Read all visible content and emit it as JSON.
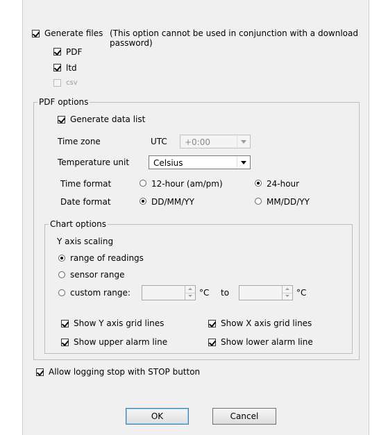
{
  "generate_files": {
    "label": "Generate files",
    "note": "(This option cannot be used in conjunction with a download\npassword)",
    "checked": true,
    "pdf": {
      "label": "PDF",
      "checked": true
    },
    "ltd": {
      "label": "ltd",
      "checked": true
    },
    "csv": {
      "label": "csv",
      "checked": false,
      "disabled": true
    }
  },
  "pdf_options": {
    "legend": "PDF options",
    "generate_data_list": {
      "label": "Generate data list",
      "checked": true
    },
    "time_zone": {
      "label": "Time zone",
      "prefix": "UTC",
      "value": "+0:00"
    },
    "temperature_unit": {
      "label": "Temperature unit",
      "value": "Celsius"
    },
    "time_format": {
      "label": "Time format",
      "option_12": "12-hour (am/pm)",
      "option_24": "24-hour",
      "selected": "24-hour"
    },
    "date_format": {
      "label": "Date format",
      "option_dmy": "DD/MM/YY",
      "option_mdy": "MM/DD/YY",
      "selected": "DD/MM/YY"
    }
  },
  "chart_options": {
    "legend": "Chart options",
    "y_axis_scaling": "Y axis scaling",
    "range_of_readings": "range of readings",
    "sensor_range": "sensor range",
    "custom_range": "custom range:",
    "selected": "range of readings",
    "unit_from": "°C",
    "to": "to",
    "unit_to": "°C",
    "show_y_grid": {
      "label": "Show Y axis grid lines",
      "checked": true
    },
    "show_x_grid": {
      "label": "Show X axis grid lines",
      "checked": true
    },
    "show_upper_alarm": {
      "label": "Show upper alarm line",
      "checked": true
    },
    "show_lower_alarm": {
      "label": "Show lower alarm line",
      "checked": true
    }
  },
  "allow_logging_stop": {
    "label": "Allow logging stop with STOP button",
    "checked": true
  },
  "buttons": {
    "ok": "OK",
    "cancel": "Cancel"
  }
}
